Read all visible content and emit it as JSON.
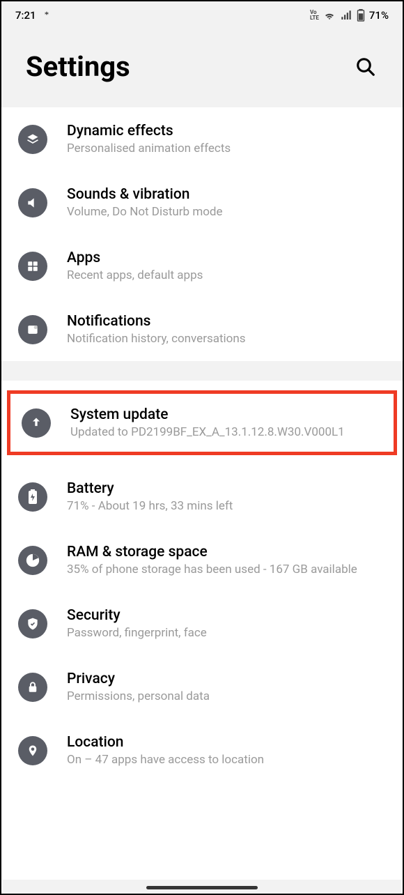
{
  "status": {
    "time": "7:21",
    "volte": "VoLTE",
    "battery": "71%"
  },
  "header": {
    "title": "Settings"
  },
  "items": {
    "dynamic_effects": {
      "title": "Dynamic effects",
      "sub": "Personalised animation effects"
    },
    "sounds": {
      "title": "Sounds & vibration",
      "sub": "Volume, Do Not Disturb mode"
    },
    "apps": {
      "title": "Apps",
      "sub": "Recent apps, default apps"
    },
    "notifications": {
      "title": "Notifications",
      "sub": "Notification history, conversations"
    },
    "system_update": {
      "title": "System update",
      "sub": "Updated to PD2199BF_EX_A_13.1.12.8.W30.V000L1"
    },
    "battery": {
      "title": "Battery",
      "sub": "71% - About 19 hrs, 33 mins left"
    },
    "ram": {
      "title": "RAM & storage space",
      "sub": "35% of phone storage has been used - 167 GB available"
    },
    "security": {
      "title": "Security",
      "sub": "Password, fingerprint, face"
    },
    "privacy": {
      "title": "Privacy",
      "sub": "Permissions, personal data"
    },
    "location": {
      "title": "Location",
      "sub": "On – 47 apps have access to location"
    }
  }
}
